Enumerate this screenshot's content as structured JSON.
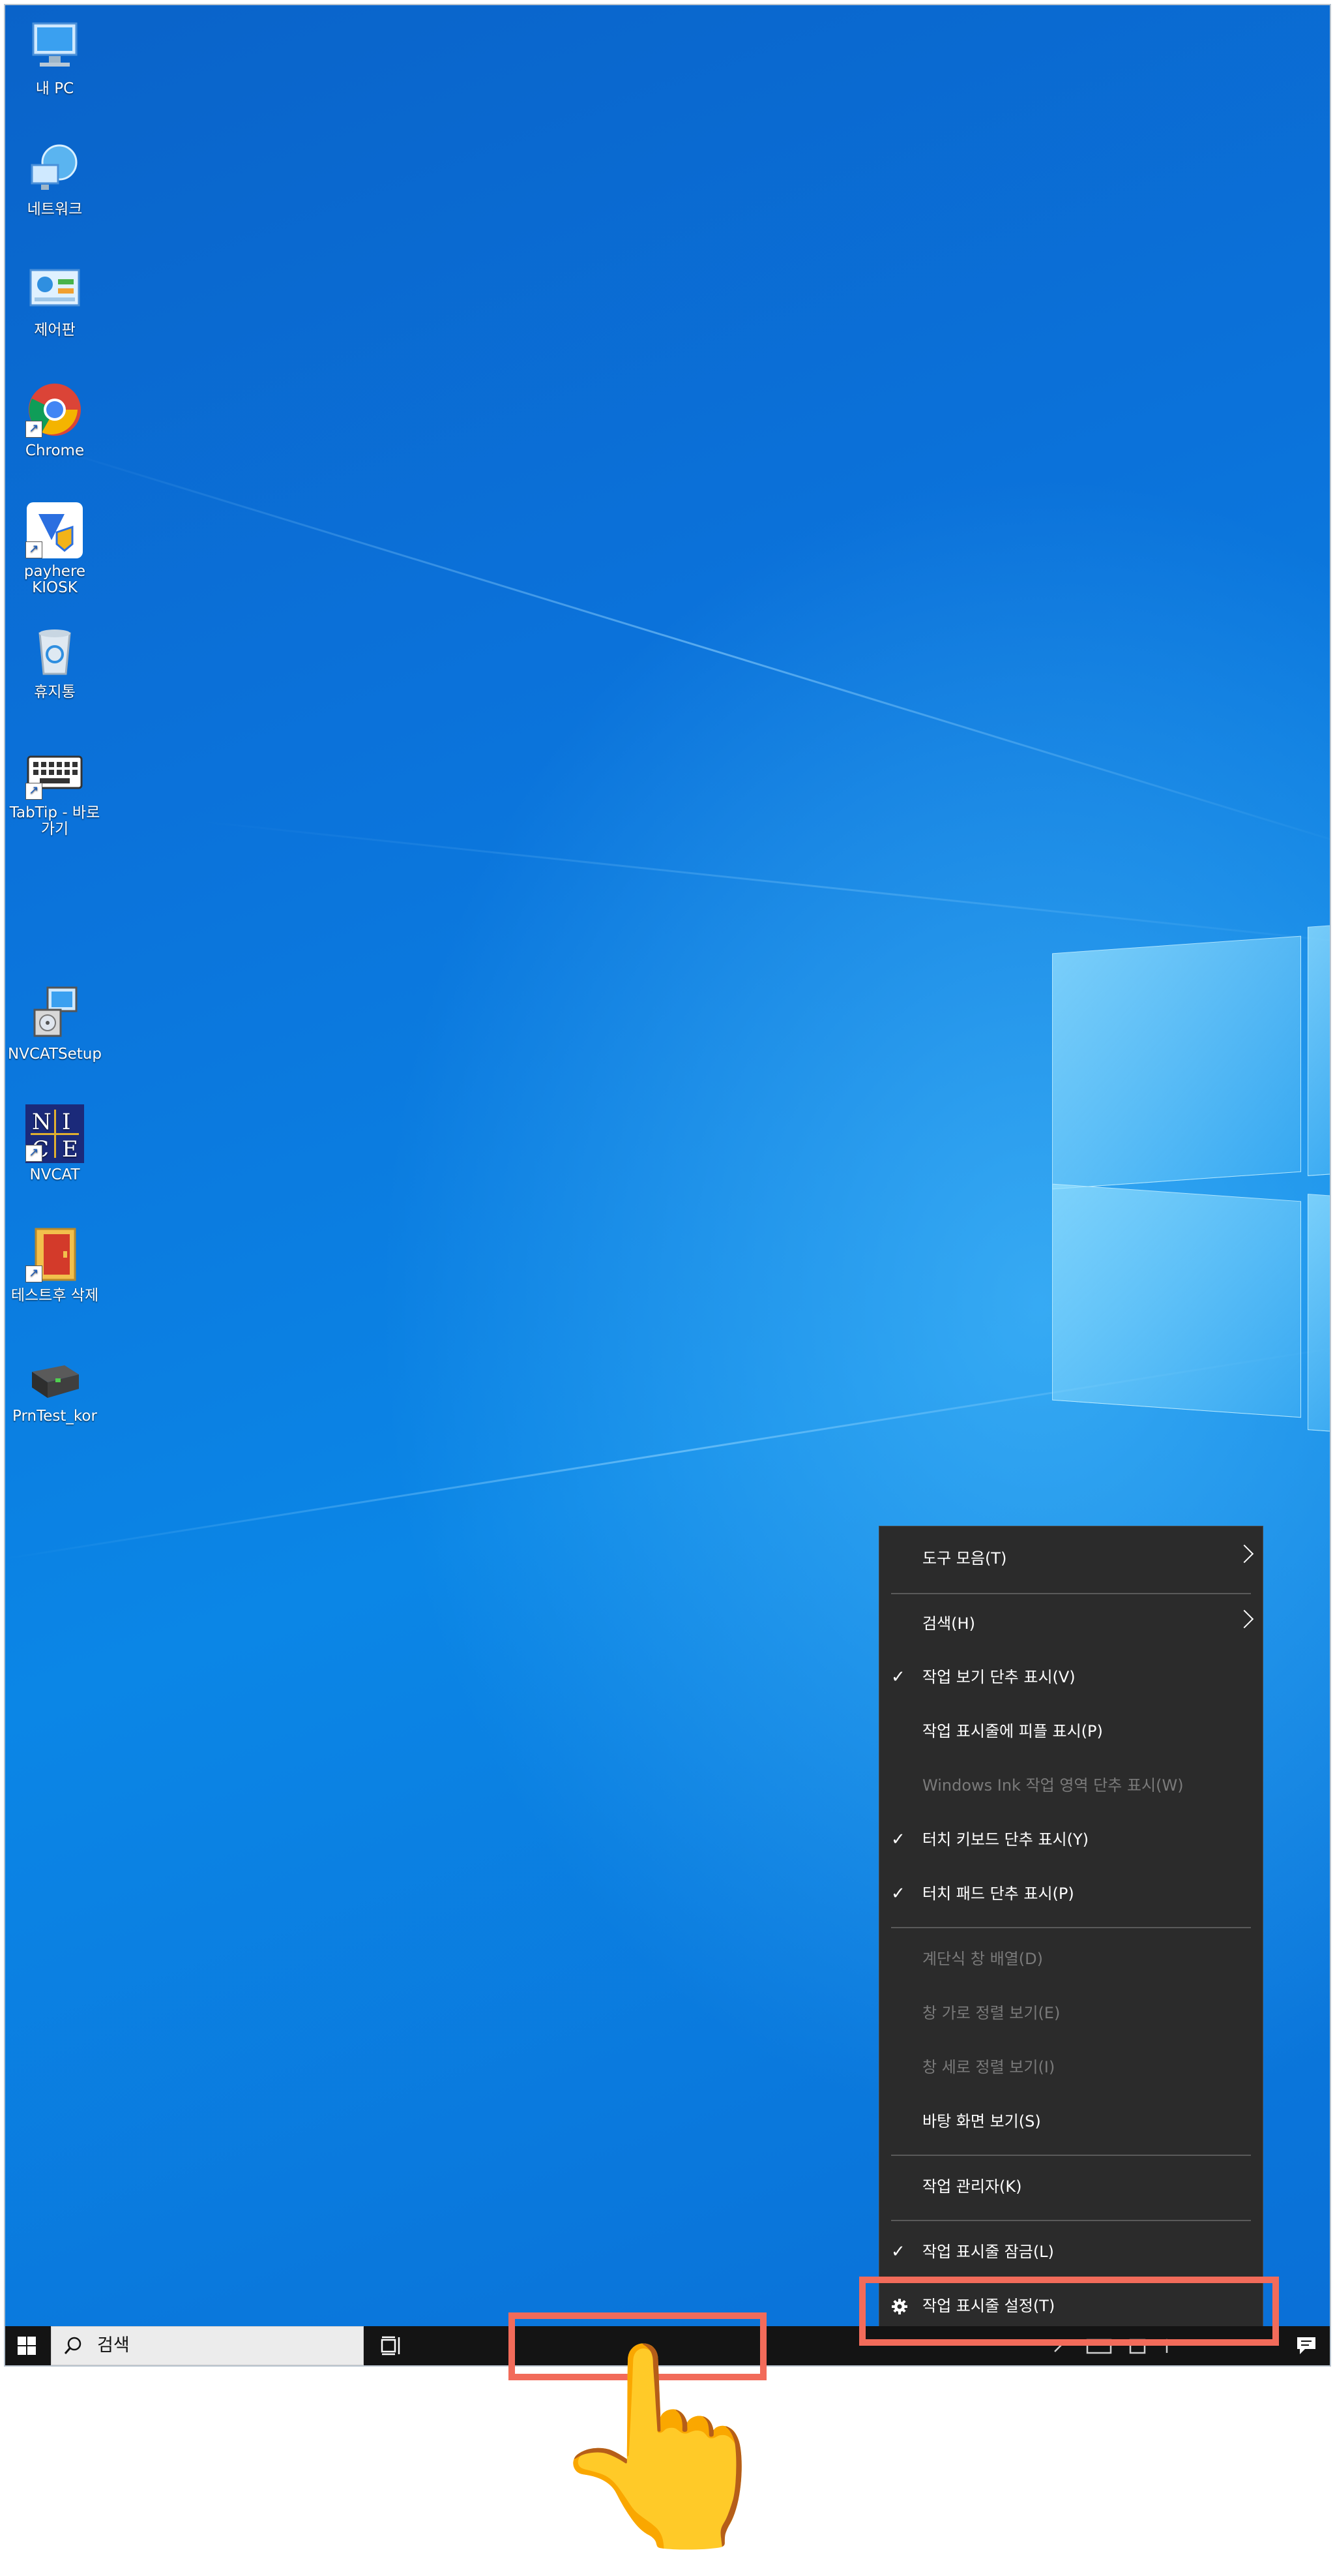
{
  "desktop": {
    "icons": [
      {
        "label": "내 PC",
        "icon": "this-pc-icon"
      },
      {
        "label": "네트워크",
        "icon": "network-icon"
      },
      {
        "label": "제어판",
        "icon": "control-panel-icon"
      },
      {
        "label": "Chrome",
        "icon": "chrome-icon"
      },
      {
        "label": "payhere KIOSK",
        "icon": "payhere-kiosk-icon"
      },
      {
        "label": "휴지통",
        "icon": "recycle-bin-icon"
      },
      {
        "label": "TabTip - 바로 가기",
        "icon": "keyboard-icon"
      },
      {
        "label": "NVCATSetup",
        "icon": "installer-icon"
      },
      {
        "label": "NVCAT",
        "icon": "nvcat-icon"
      },
      {
        "label": "테스트후 삭제",
        "icon": "folder-icon"
      },
      {
        "label": "PrnTest_kor",
        "icon": "printer-icon"
      }
    ]
  },
  "context_menu": {
    "items": [
      {
        "label": "도구 모음(T)",
        "checked": false,
        "submenu": true,
        "disabled": false
      },
      {
        "label": "검색(H)",
        "checked": false,
        "submenu": true,
        "disabled": false
      },
      {
        "label": "작업 보기 단추 표시(V)",
        "checked": true,
        "submenu": false,
        "disabled": false
      },
      {
        "label": "작업 표시줄에 피플 표시(P)",
        "checked": false,
        "submenu": false,
        "disabled": false
      },
      {
        "label": "Windows Ink 작업 영역 단추 표시(W)",
        "checked": false,
        "submenu": false,
        "disabled": true
      },
      {
        "label": "터치 키보드 단추 표시(Y)",
        "checked": true,
        "submenu": false,
        "disabled": false
      },
      {
        "label": "터치 패드 단추 표시(P)",
        "checked": true,
        "submenu": false,
        "disabled": false
      },
      {
        "label": "계단식 창 배열(D)",
        "checked": false,
        "submenu": false,
        "disabled": true
      },
      {
        "label": "창 가로 정렬 보기(E)",
        "checked": false,
        "submenu": false,
        "disabled": true
      },
      {
        "label": "창 세로 정렬 보기(I)",
        "checked": false,
        "submenu": false,
        "disabled": true
      },
      {
        "label": "바탕 화면 보기(S)",
        "checked": false,
        "submenu": false,
        "disabled": false
      },
      {
        "label": "작업 관리자(K)",
        "checked": false,
        "submenu": false,
        "disabled": false
      },
      {
        "label": "작업 표시줄 잠금(L)",
        "checked": true,
        "submenu": false,
        "disabled": false
      },
      {
        "label": "작업 표시줄 설정(T)",
        "checked": false,
        "submenu": false,
        "disabled": false,
        "icon": "gear-icon"
      }
    ],
    "check_glyph": "✓"
  },
  "taskbar": {
    "search_placeholder": "검색"
  },
  "annotation": {
    "highlight_color": "#f26b5a",
    "pointer": "👆"
  }
}
